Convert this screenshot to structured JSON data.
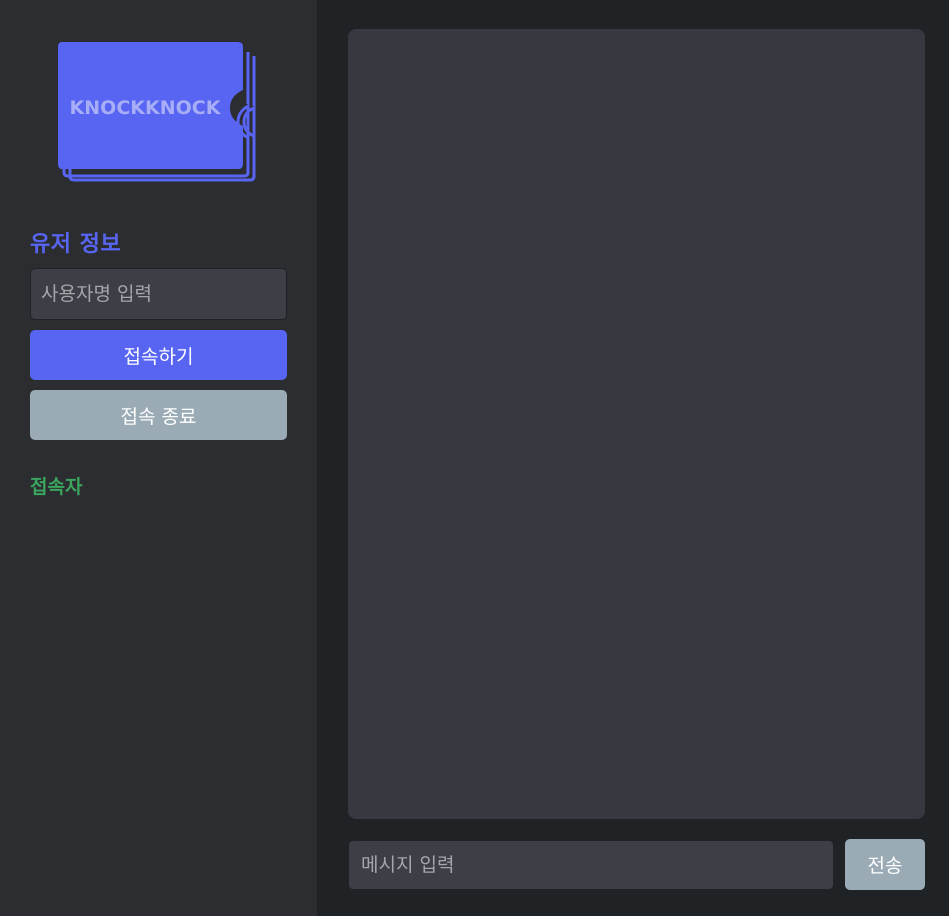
{
  "logo": {
    "text": "KNOCKKNOCK",
    "color": "#5865f2",
    "text_color": "#a7aef7"
  },
  "sidebar": {
    "title": "유저 정보",
    "username_placeholder": "사용자명 입력",
    "connect_label": "접속하기",
    "disconnect_label": "접속 종료",
    "users_title": "접속자"
  },
  "chat": {
    "message_placeholder": "메시지 입력",
    "send_label": "전송"
  },
  "colors": {
    "accent": "#5865f2",
    "online": "#3ba55d",
    "muted_button": "#9aabb5"
  }
}
